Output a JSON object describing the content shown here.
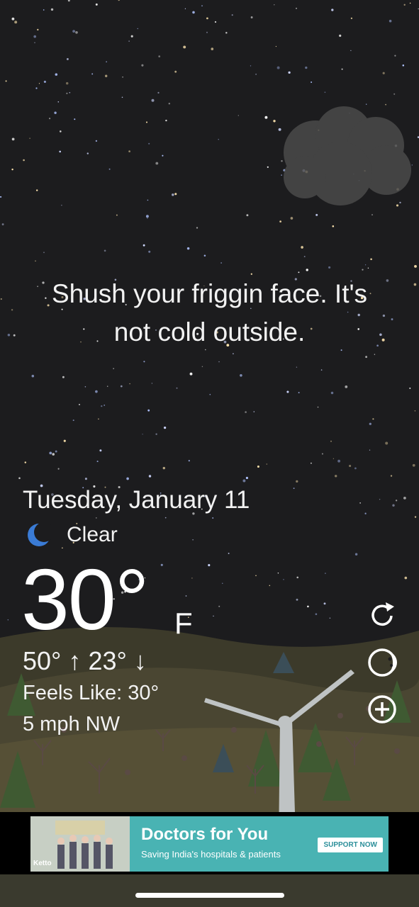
{
  "message": {
    "line1": "Shush your friggin face. It's",
    "line2": "not cold outside."
  },
  "weather": {
    "date": "Tuesday, January 11",
    "condition": "Clear",
    "condition_icon": "moon-icon",
    "temperature": "30°",
    "unit": "F",
    "high_low": "50° ↑  23° ↓",
    "feels_like": "Feels Like: 30°",
    "wind": "5 mph NW"
  },
  "actions": [
    {
      "name": "refresh",
      "icon": "refresh-icon"
    },
    {
      "name": "theme",
      "icon": "moon-phase-icon"
    },
    {
      "name": "add",
      "icon": "plus-circle-icon"
    }
  ],
  "ad": {
    "title": "Doctors for You",
    "subtitle": "Saving India's hospitals & patients",
    "button": "SUPPORT NOW",
    "brand": "Ketto"
  },
  "colors": {
    "sky": "#1c1c1e",
    "ad_bg": "#49b3b3",
    "moon": "#3a7bd5"
  }
}
